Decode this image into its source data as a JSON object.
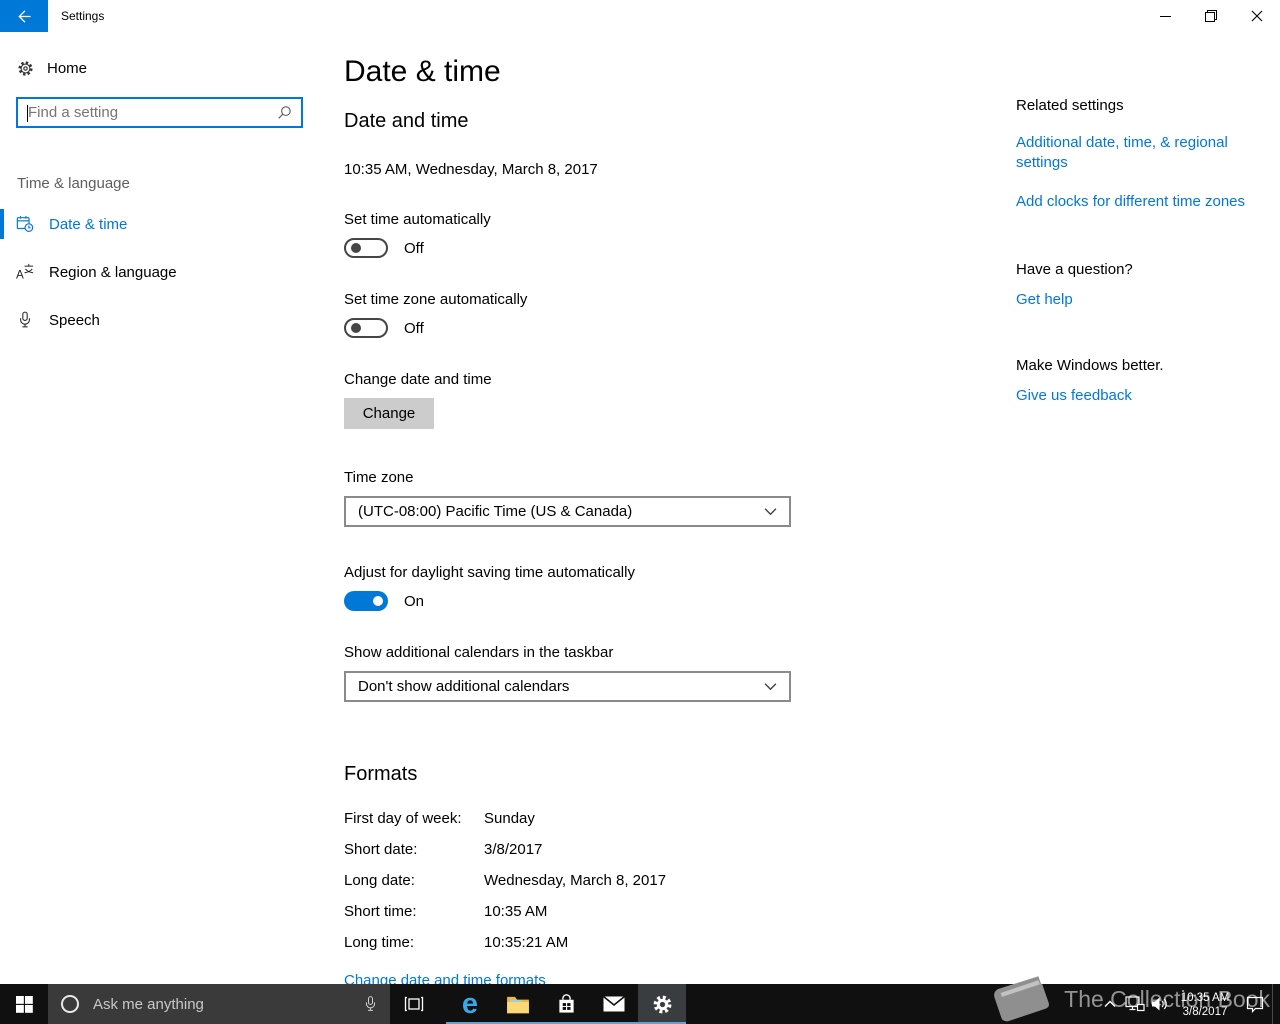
{
  "titlebar": {
    "title": "Settings"
  },
  "sidebar": {
    "home_label": "Home",
    "search_placeholder": "Find a setting",
    "group_label": "Time & language",
    "items": [
      {
        "label": "Date & time",
        "selected": true
      },
      {
        "label": "Region & language",
        "selected": false
      },
      {
        "label": "Speech",
        "selected": false
      }
    ]
  },
  "main": {
    "page_title": "Date & time",
    "datetime": {
      "heading": "Date and time",
      "current": "10:35 AM, Wednesday, March 8, 2017",
      "set_time_label": "Set time automatically",
      "set_time_state": "Off",
      "set_zone_label": "Set time zone automatically",
      "set_zone_state": "Off",
      "change_label": "Change date and time",
      "change_button": "Change",
      "timezone_label": "Time zone",
      "timezone_value": "(UTC-08:00) Pacific Time (US & Canada)",
      "dst_label": "Adjust for daylight saving time automatically",
      "dst_state": "On",
      "calendars_label": "Show additional calendars in the taskbar",
      "calendars_value": "Don't show additional calendars"
    },
    "formats": {
      "heading": "Formats",
      "rows": [
        {
          "label": "First day of week:",
          "value": "Sunday"
        },
        {
          "label": "Short date:",
          "value": "3/8/2017"
        },
        {
          "label": "Long date:",
          "value": "Wednesday, March 8, 2017"
        },
        {
          "label": "Short time:",
          "value": "10:35 AM"
        },
        {
          "label": "Long time:",
          "value": "10:35:21 AM"
        }
      ],
      "change_link": "Change date and time formats"
    }
  },
  "related": {
    "heading": "Related settings",
    "link_regional": "Additional date, time, & regional settings",
    "link_clocks": "Add clocks for different time zones",
    "question_heading": "Have a question?",
    "question_link": "Get help",
    "feedback_heading": "Make Windows better.",
    "feedback_link": "Give us feedback"
  },
  "taskbar": {
    "search_placeholder": "Ask me anything",
    "clock_time": "10:35 AM",
    "clock_date": "3/8/2017"
  },
  "watermark": {
    "text": "The Collection Book"
  },
  "colors": {
    "accent": "#0078d7",
    "taskbar": "#101010",
    "button_gray": "#cccccc"
  }
}
